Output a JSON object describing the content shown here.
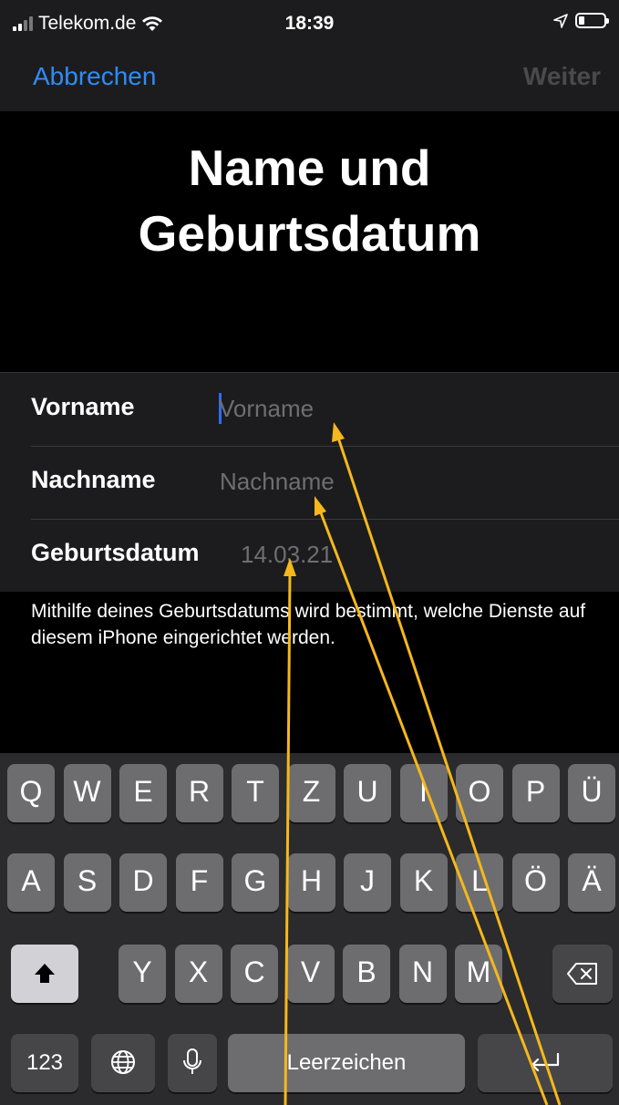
{
  "status": {
    "carrier": "Telekom.de",
    "time": "18:39"
  },
  "nav": {
    "cancel": "Abbrechen",
    "next": "Weiter"
  },
  "title": {
    "line1": "Name und",
    "line2": "Geburtsdatum"
  },
  "form": {
    "first_name": {
      "label": "Vorname",
      "placeholder": "Vorname"
    },
    "last_name": {
      "label": "Nachname",
      "placeholder": "Nachname"
    },
    "birthdate": {
      "label": "Geburtsdatum",
      "value": "14.03.21"
    }
  },
  "hint": "Mithilfe deines Geburtsdatums wird bestimmt, welche Dienste auf diesem iPhone eingerichtet werden.",
  "keyboard": {
    "row1": [
      "Q",
      "W",
      "E",
      "R",
      "T",
      "Z",
      "U",
      "I",
      "O",
      "P",
      "Ü"
    ],
    "row2": [
      "A",
      "S",
      "D",
      "F",
      "G",
      "H",
      "J",
      "K",
      "L",
      "Ö",
      "Ä"
    ],
    "row3": [
      "Y",
      "X",
      "C",
      "V",
      "B",
      "N",
      "M"
    ],
    "numbers": "123",
    "space": "Leerzeichen"
  },
  "colors": {
    "accent": "#2f8cf6",
    "annotation": "#f5b81c"
  }
}
